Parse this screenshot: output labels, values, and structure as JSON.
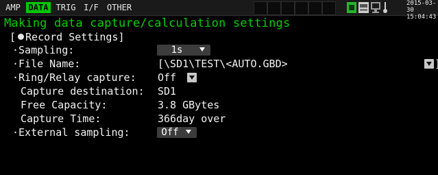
{
  "tabs": [
    {
      "label": "AMP",
      "active": false
    },
    {
      "label": "DATA",
      "active": true
    },
    {
      "label": "TRIG",
      "active": false
    },
    {
      "label": "I/F",
      "active": false
    },
    {
      "label": "OTHER",
      "active": false
    }
  ],
  "status": {
    "date": "2015-03-30",
    "time": "15:04:43",
    "icons": [
      "sd-card-icon",
      "memory-icon",
      "network-icon",
      "thermometer-icon"
    ]
  },
  "title": "Making data capture/calculation settings",
  "section_label": "[",
  "section_title": "Record Settings]",
  "settings": {
    "sampling": {
      "label": "·Sampling:",
      "value": "1s"
    },
    "file_name": {
      "label": "·File Name:",
      "value": "[\\SD1\\TEST\\<AUTO.GBD>"
    },
    "ring_relay": {
      "label": "·Ring/Relay capture:",
      "value": "Off"
    },
    "destination": {
      "label": "Capture destination:",
      "value": "SD1"
    },
    "free_capacity": {
      "label": "Free Capacity:",
      "value": "3.8 GBytes"
    },
    "capture_time": {
      "label": "Capture Time:",
      "value": "366day over"
    },
    "external_sampling": {
      "label": "·External sampling:",
      "value": "Off"
    }
  },
  "colors": {
    "background": "#000000",
    "title": "#00d000",
    "active_tab": "#00c800"
  }
}
